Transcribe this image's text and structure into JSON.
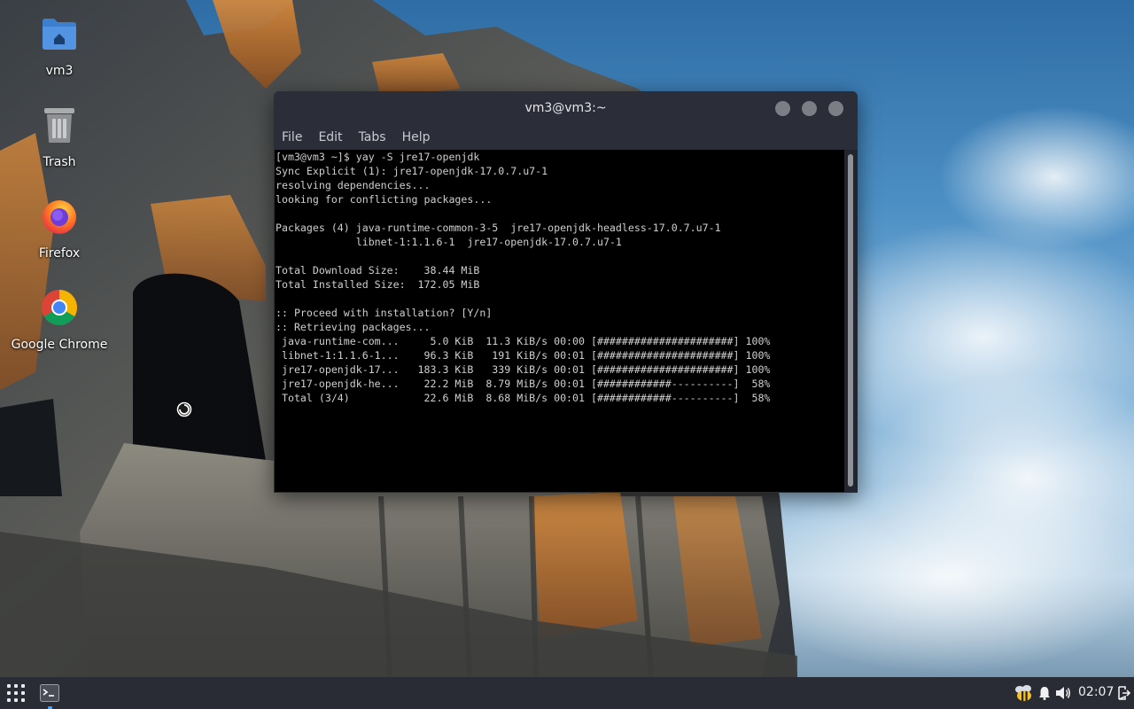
{
  "desktop": {
    "icons": [
      {
        "label": "vm3",
        "icon": "home-folder-icon"
      },
      {
        "label": "Trash",
        "icon": "trash-icon"
      },
      {
        "label": "Firefox",
        "icon": "firefox-icon"
      },
      {
        "label": "Google Chrome",
        "icon": "chrome-icon"
      }
    ]
  },
  "terminal": {
    "title": "vm3@vm3:~",
    "menu": [
      "File",
      "Edit",
      "Tabs",
      "Help"
    ],
    "lines": [
      "[vm3@vm3 ~]$ yay -S jre17-openjdk",
      "Sync Explicit (1): jre17-openjdk-17.0.7.u7-1",
      "resolving dependencies...",
      "looking for conflicting packages...",
      "",
      "Packages (4) java-runtime-common-3-5  jre17-openjdk-headless-17.0.7.u7-1",
      "             libnet-1:1.1.6-1  jre17-openjdk-17.0.7.u7-1",
      "",
      "Total Download Size:    38.44 MiB",
      "Total Installed Size:  172.05 MiB",
      "",
      ":: Proceed with installation? [Y/n]",
      ":: Retrieving packages...",
      " java-runtime-com...     5.0 KiB  11.3 KiB/s 00:00 [######################] 100%",
      " libnet-1:1.1.6-1...    96.3 KiB   191 KiB/s 00:01 [######################] 100%",
      " jre17-openjdk-17...   183.3 KiB   339 KiB/s 00:01 [######################] 100%",
      " jre17-openjdk-he...    22.2 MiB  8.79 MiB/s 00:01 [############----------]  58%",
      " Total (3/4)            22.6 MiB  8.68 MiB/s 00:01 [############----------]  58%"
    ]
  },
  "taskbar": {
    "clock": "02:07",
    "tray_icons": [
      "bee-icon",
      "bell-icon",
      "volume-icon",
      "logout-icon"
    ]
  },
  "colors": {
    "window_bg": "#2b2d38",
    "taskbar_bg": "#2a2c35",
    "terminal_bg": "#000000",
    "terminal_fg": "#cfcfcf"
  }
}
